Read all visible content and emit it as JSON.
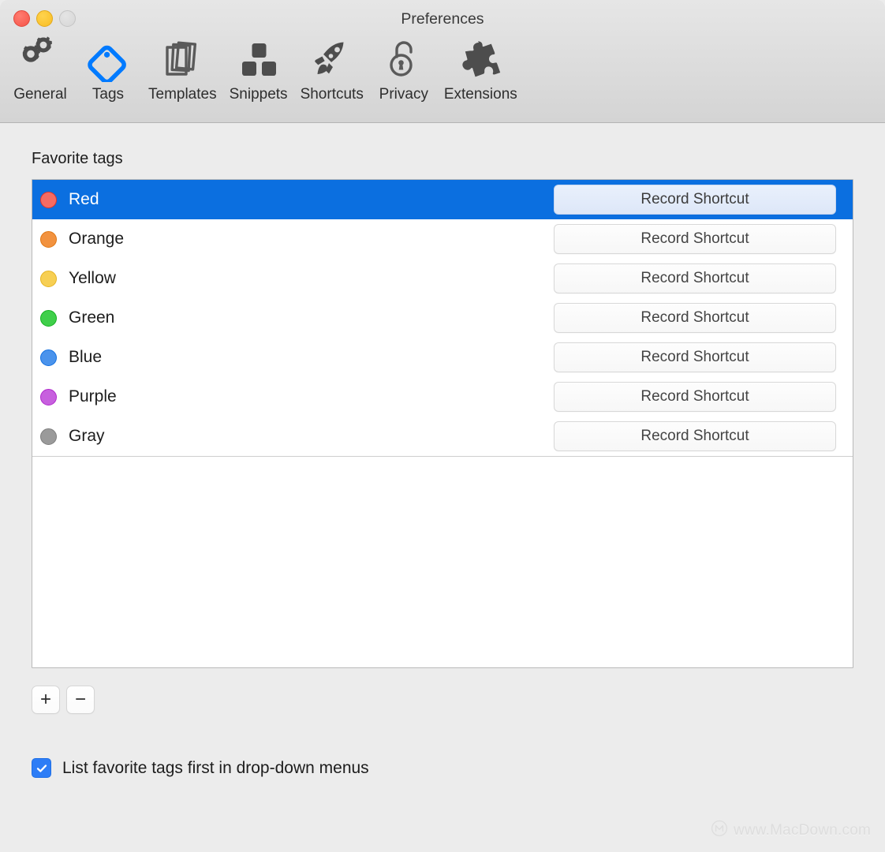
{
  "window": {
    "title": "Preferences",
    "traffic_lights": [
      {
        "name": "close",
        "color": "#f65448",
        "enabled": true
      },
      {
        "name": "minimize",
        "color": "#f8bd23",
        "enabled": true
      },
      {
        "name": "zoom",
        "color": "#d6d6d6",
        "enabled": false
      }
    ]
  },
  "toolbar": {
    "tabs": [
      {
        "label": "General",
        "icon": "gears-icon",
        "active": false
      },
      {
        "label": "Tags",
        "icon": "tag-icon",
        "active": true
      },
      {
        "label": "Templates",
        "icon": "documents-icon",
        "active": false
      },
      {
        "label": "Snippets",
        "icon": "blocks-icon",
        "active": false
      },
      {
        "label": "Shortcuts",
        "icon": "rocket-icon",
        "active": false
      },
      {
        "label": "Privacy",
        "icon": "lock-icon",
        "active": false
      },
      {
        "label": "Extensions",
        "icon": "puzzle-icon",
        "active": false
      }
    ],
    "active_accent": "#007AFF"
  },
  "main": {
    "section_title": "Favorite tags",
    "shortcut_button_label": "Record Shortcut",
    "selection_color": "#0b6fe0",
    "tags": [
      {
        "name": "Red",
        "color": "#f56b63",
        "ring": "#e0342a",
        "selected": true
      },
      {
        "name": "Orange",
        "color": "#f2923f",
        "ring": "#df7714",
        "selected": false
      },
      {
        "name": "Yellow",
        "color": "#f7cf53",
        "ring": "#e5b424",
        "selected": false
      },
      {
        "name": "Green",
        "color": "#3fcf4a",
        "ring": "#16b022",
        "selected": false
      },
      {
        "name": "Blue",
        "color": "#4a93ec",
        "ring": "#1471e0",
        "selected": false
      },
      {
        "name": "Purple",
        "color": "#c760de",
        "ring": "#b029cc",
        "selected": false
      },
      {
        "name": "Gray",
        "color": "#9a9a9a",
        "ring": "#7f7f7f",
        "selected": false
      }
    ],
    "add_button_label": "+",
    "remove_button_label": "−",
    "checkbox": {
      "label": "List favorite tags first in drop-down menus",
      "checked": true,
      "color": "#2d7df6"
    }
  },
  "watermark": {
    "text": "www.MacDown.com",
    "logo": "macdown-circle-m-icon"
  }
}
